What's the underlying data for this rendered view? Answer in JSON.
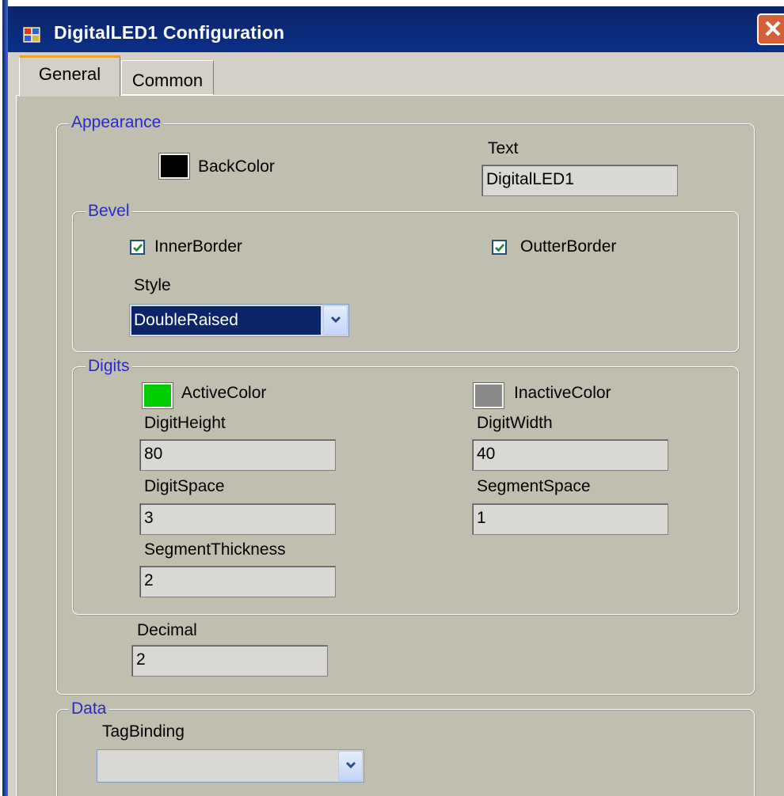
{
  "window": {
    "title": "DigitalLED1 Configuration",
    "close_glyph": "✕",
    "icon": "app-window-icon"
  },
  "tabs": [
    {
      "label": "General",
      "selected": true
    },
    {
      "label": "Common",
      "selected": false
    }
  ],
  "appearance": {
    "group_label": "Appearance",
    "backcolor_label": "BackColor",
    "backcolor": "#000000",
    "text_label": "Text",
    "text_value": "DigitalLED1"
  },
  "bevel": {
    "group_label": "Bevel",
    "inner_border_label": "InnerBorder",
    "inner_border_checked": true,
    "outter_border_label": "OutterBorder",
    "outter_border_checked": true,
    "style_label": "Style",
    "style_value": "DoubleRaised"
  },
  "digits": {
    "group_label": "Digits",
    "active_color_label": "ActiveColor",
    "active_color": "#00cc00",
    "inactive_color_label": "InactiveColor",
    "inactive_color": "#8a8a8a",
    "digit_height_label": "DigitHeight",
    "digit_height_value": "80",
    "digit_width_label": "DigitWidth",
    "digit_width_value": "40",
    "digit_space_label": "DigitSpace",
    "digit_space_value": "3",
    "segment_space_label": "SegmentSpace",
    "segment_space_value": "1",
    "segment_thickness_label": "SegmentThickness",
    "segment_thickness_value": "2"
  },
  "decimal": {
    "label": "Decimal",
    "value": "2"
  },
  "data": {
    "group_label": "Data",
    "tag_binding_label": "TagBinding",
    "tag_binding_value": ""
  },
  "colors": {
    "title_bar": "#0a246a",
    "group_label_text": "#2a2ac8",
    "panel_bg": "#bfbeaf",
    "selection": "#0a246a"
  }
}
